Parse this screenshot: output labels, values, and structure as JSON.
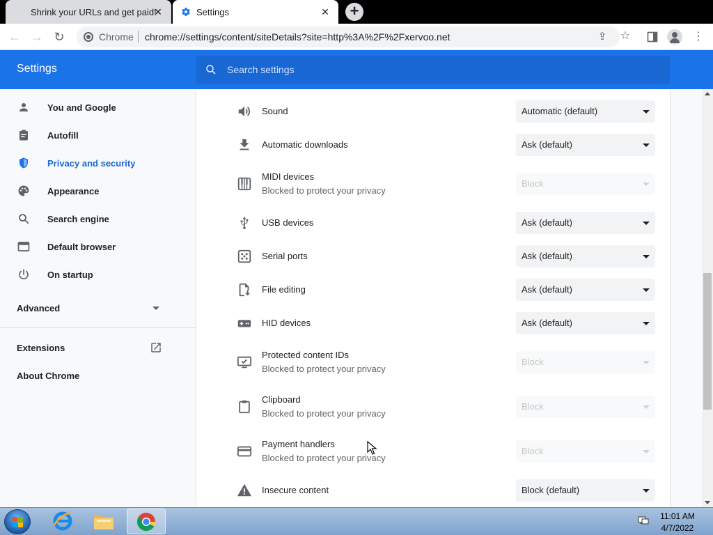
{
  "browser": {
    "tabs": [
      {
        "title": "Shrink your URLs and get paid!",
        "active": false
      },
      {
        "title": "Settings",
        "active": true
      }
    ],
    "omnibox": {
      "site_label": "Chrome",
      "url": "chrome://settings/content/siteDetails?site=http%3A%2F%2Fxervoo.net"
    }
  },
  "header": {
    "title": "Settings",
    "search_placeholder": "Search settings"
  },
  "sidebar": {
    "items": [
      {
        "label": "You and Google",
        "icon": "person-icon"
      },
      {
        "label": "Autofill",
        "icon": "clipboard-icon"
      },
      {
        "label": "Privacy and security",
        "icon": "shield-icon",
        "active": true
      },
      {
        "label": "Appearance",
        "icon": "palette-icon"
      },
      {
        "label": "Search engine",
        "icon": "search-icon"
      },
      {
        "label": "Default browser",
        "icon": "browser-window-icon"
      },
      {
        "label": "On startup",
        "icon": "power-icon"
      }
    ],
    "advanced_label": "Advanced",
    "extensions_label": "Extensions",
    "about_label": "About Chrome"
  },
  "permissions": [
    {
      "title": "Sound",
      "subtitle": "",
      "value": "Automatic (default)",
      "disabled": false,
      "icon": "speaker-icon"
    },
    {
      "title": "Automatic downloads",
      "subtitle": "",
      "value": "Ask (default)",
      "disabled": false,
      "icon": "download-icon"
    },
    {
      "title": "MIDI devices",
      "subtitle": "Blocked to protect your privacy",
      "value": "Block",
      "disabled": true,
      "icon": "piano-icon"
    },
    {
      "title": "USB devices",
      "subtitle": "",
      "value": "Ask (default)",
      "disabled": false,
      "icon": "usb-icon"
    },
    {
      "title": "Serial ports",
      "subtitle": "",
      "value": "Ask (default)",
      "disabled": false,
      "icon": "serial-port-icon"
    },
    {
      "title": "File editing",
      "subtitle": "",
      "value": "Ask (default)",
      "disabled": false,
      "icon": "file-edit-icon"
    },
    {
      "title": "HID devices",
      "subtitle": "",
      "value": "Ask (default)",
      "disabled": false,
      "icon": "gamepad-icon"
    },
    {
      "title": "Protected content IDs",
      "subtitle": "Blocked to protect your privacy",
      "value": "Block",
      "disabled": true,
      "icon": "monitor-check-icon"
    },
    {
      "title": "Clipboard",
      "subtitle": "Blocked to protect your privacy",
      "value": "Block",
      "disabled": true,
      "icon": "clipboard-icon"
    },
    {
      "title": "Payment handlers",
      "subtitle": "Blocked to protect your privacy",
      "value": "Block",
      "disabled": true,
      "icon": "credit-card-icon"
    },
    {
      "title": "Insecure content",
      "subtitle": "",
      "value": "Block (default)",
      "disabled": false,
      "icon": "warning-icon"
    }
  ],
  "taskbar": {
    "time": "11:01 AM",
    "date": "4/7/2022"
  },
  "colors": {
    "accent": "#1a73e8",
    "accent_dark": "#1967d2"
  }
}
